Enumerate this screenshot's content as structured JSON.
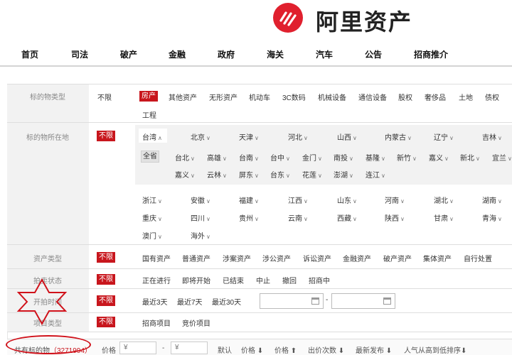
{
  "brand": {
    "name": "阿里资产",
    "accent": "#e0202e"
  },
  "nav": [
    "首页",
    "司法",
    "破产",
    "金融",
    "政府",
    "海关",
    "汽车",
    "公告",
    "招商推介"
  ],
  "filters": {
    "unlimited": "不限",
    "labels": {
      "type": "标的物类型",
      "location": "标的物所在地",
      "asset_type": "资产类型",
      "auction_status": "拍卖状态",
      "start_time": "开拍时间",
      "project_type": "项目类型"
    },
    "types": [
      "房产",
      "其他资产",
      "无形资产",
      "机动车",
      "3C数码",
      "机械设备",
      "通信设备",
      "股权",
      "奢侈品",
      "土地",
      "债权",
      "工程"
    ],
    "regions_row1": [
      "台湾",
      "北京",
      "天津",
      "河北",
      "山西",
      "内蒙古",
      "辽宁",
      "吉林"
    ],
    "all_province": "全省",
    "taiwan_cities": [
      "台北",
      "高雄",
      "台南",
      "台中",
      "金门",
      "南投",
      "基隆",
      "新竹",
      "嘉义",
      "新北",
      "宜兰",
      "嘉义",
      "云林",
      "屏东",
      "台东",
      "花莲",
      "澎湖",
      "连江"
    ],
    "regions_more": [
      "浙江",
      "安徽",
      "福建",
      "江西",
      "山东",
      "河南",
      "湖北",
      "湖南",
      "重庆",
      "四川",
      "贵州",
      "云南",
      "西藏",
      "陕西",
      "甘肃",
      "青海",
      "澳门",
      "海外"
    ],
    "asset_types": [
      "国有资产",
      "普通资产",
      "涉案资产",
      "涉公资产",
      "诉讼资产",
      "金融资产",
      "破产资产",
      "集体资产",
      "自行处置"
    ],
    "statuses": [
      "正在进行",
      "即将开始",
      "已结束",
      "中止",
      "撤回",
      "招商中"
    ],
    "times": [
      "最近3天",
      "最近7天",
      "最近30天"
    ],
    "date_separator": "-",
    "project_types": [
      "招商项目",
      "竞价项目"
    ]
  },
  "sortbar": {
    "total_prefix": "共有标的物",
    "total_count": "（3271994）",
    "price_label": "价格",
    "price_min_placeholder": "¥",
    "price_sep": "-",
    "price_max_placeholder": "¥",
    "items": [
      "默认",
      "价格 ⬇",
      "价格 ⬆",
      "出价次数 ⬇",
      "最新发布 ⬇",
      "人气从高到低排序⬇"
    ]
  },
  "annotations": {
    "highlight_color": "#d0121b"
  }
}
